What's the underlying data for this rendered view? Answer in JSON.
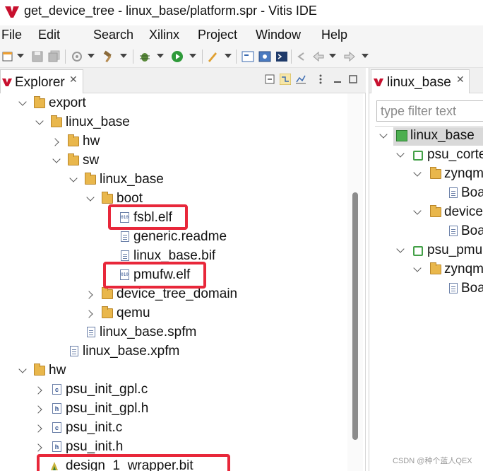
{
  "window": {
    "title": "get_device_tree - linux_base/platform.spr - Vitis IDE"
  },
  "menu": [
    {
      "label": "File"
    },
    {
      "label": "Edit"
    },
    {
      "label": "Search"
    },
    {
      "label": "Xilinx"
    },
    {
      "label": "Project"
    },
    {
      "label": "Window"
    },
    {
      "label": "Help"
    }
  ],
  "explorer": {
    "tab_label": "Explorer",
    "tree": [
      {
        "label": "export"
      },
      {
        "label": "linux_base"
      },
      {
        "label": "hw"
      },
      {
        "label": "sw"
      },
      {
        "label": "linux_base"
      },
      {
        "label": "boot"
      },
      {
        "label": "fsbl.elf"
      },
      {
        "label": "generic.readme"
      },
      {
        "label": "linux_base.bif"
      },
      {
        "label": "pmufw.elf"
      },
      {
        "label": "device_tree_domain"
      },
      {
        "label": "qemu"
      },
      {
        "label": "linux_base.spfm"
      },
      {
        "label": "linux_base.xpfm"
      },
      {
        "label": "hw"
      },
      {
        "label": "psu_init_gpl.c"
      },
      {
        "label": "psu_init_gpl.h"
      },
      {
        "label": "psu_init.c"
      },
      {
        "label": "psu_init.h"
      },
      {
        "label": "design_1_wrapper.bit"
      }
    ]
  },
  "outline": {
    "tab_label": "linux_base",
    "filter_placeholder": "type filter text",
    "tree": [
      {
        "label": "linux_base"
      },
      {
        "label": "psu_corte"
      },
      {
        "label": "zynqm"
      },
      {
        "label": "Boa"
      },
      {
        "label": "device"
      },
      {
        "label": "Boa"
      },
      {
        "label": "psu_pmu"
      },
      {
        "label": "zynqm"
      },
      {
        "label": "Boa"
      }
    ]
  },
  "watermark": "CSDN @种个蓝人QEX",
  "colors": {
    "highlight_box": "#e8273a",
    "folder": "#e9b74c",
    "selection": "#d9d9d9"
  }
}
